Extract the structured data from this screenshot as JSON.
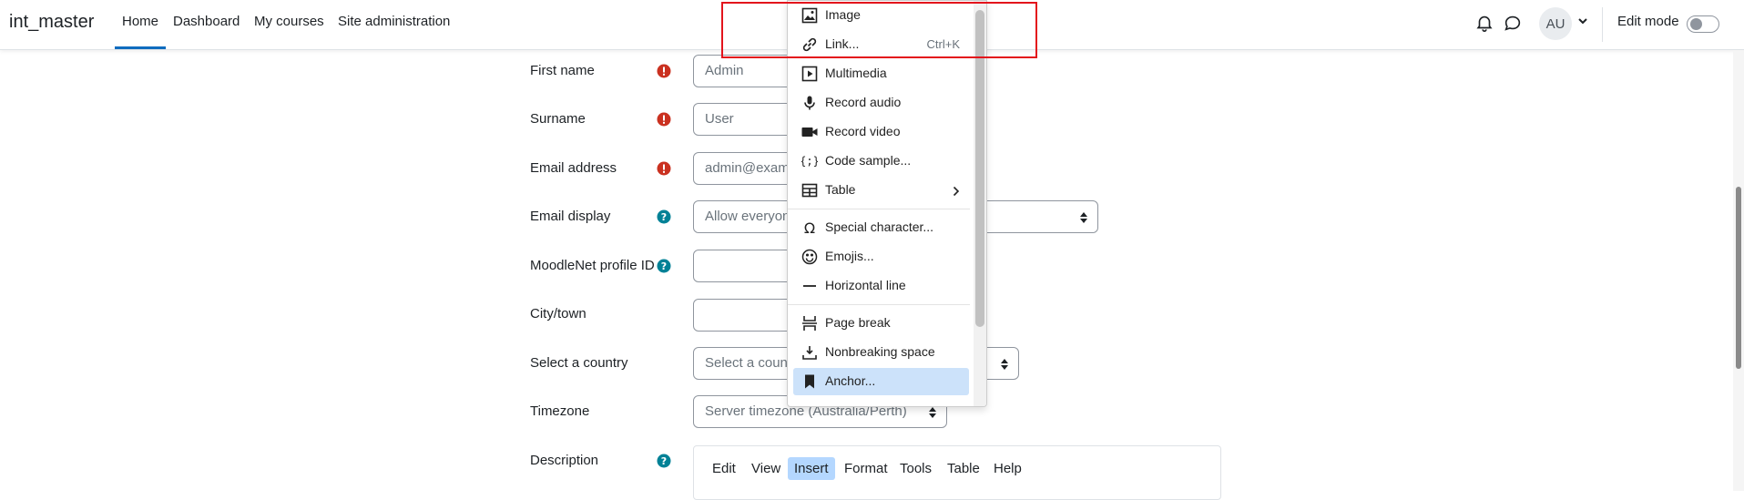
{
  "header": {
    "brand": "int_master",
    "nav": [
      "Home",
      "Dashboard",
      "My courses",
      "Site administration"
    ],
    "avatar_initials": "AU",
    "edit_mode_label": "Edit mode",
    "edit_mode_on": false,
    "accent_color": "#0f6cbf"
  },
  "form": {
    "first_name_label": "First name",
    "first_name_value": "Admin",
    "surname_label": "Surname",
    "surname_value": "User",
    "email_label": "Email address",
    "email_value": "admin@exam",
    "email_display_label": "Email display",
    "email_display_value": "Allow everyon",
    "moodlenet_label": "MoodleNet profile ID",
    "city_label": "City/town",
    "country_label": "Select a country",
    "country_value": "Select a coun",
    "timezone_label": "Timezone",
    "timezone_value": "Server timezone (Australia/Perth)",
    "description_label": "Description",
    "required_color": "#ca3120",
    "help_color": "#008196"
  },
  "editor_menubar": [
    "Edit",
    "View",
    "Insert",
    "Format",
    "Tools",
    "Table",
    "Help"
  ],
  "editor_active_menu": "Insert",
  "insert_menu": {
    "items": [
      {
        "label": "Image",
        "icon": "image-icon"
      },
      {
        "label": "Link...",
        "icon": "link-icon",
        "shortcut": "Ctrl+K"
      },
      {
        "label": "Multimedia",
        "icon": "multimedia-icon"
      },
      {
        "label": "Record audio",
        "icon": "microphone-icon"
      },
      {
        "label": "Record video",
        "icon": "video-camera-icon"
      },
      {
        "label": "Code sample...",
        "icon": "code-sample-icon"
      },
      {
        "label": "Table",
        "icon": "table-icon",
        "submenu": true
      },
      {
        "label": "Special character...",
        "icon": "omega-icon"
      },
      {
        "label": "Emojis...",
        "icon": "emoji-icon"
      },
      {
        "label": "Horizontal line",
        "icon": "horizontal-line-icon"
      },
      {
        "label": "Page break",
        "icon": "page-break-icon"
      },
      {
        "label": "Nonbreaking space",
        "icon": "nonbreaking-space-icon"
      },
      {
        "label": "Anchor...",
        "icon": "bookmark-icon",
        "highlighted": true
      }
    ]
  }
}
